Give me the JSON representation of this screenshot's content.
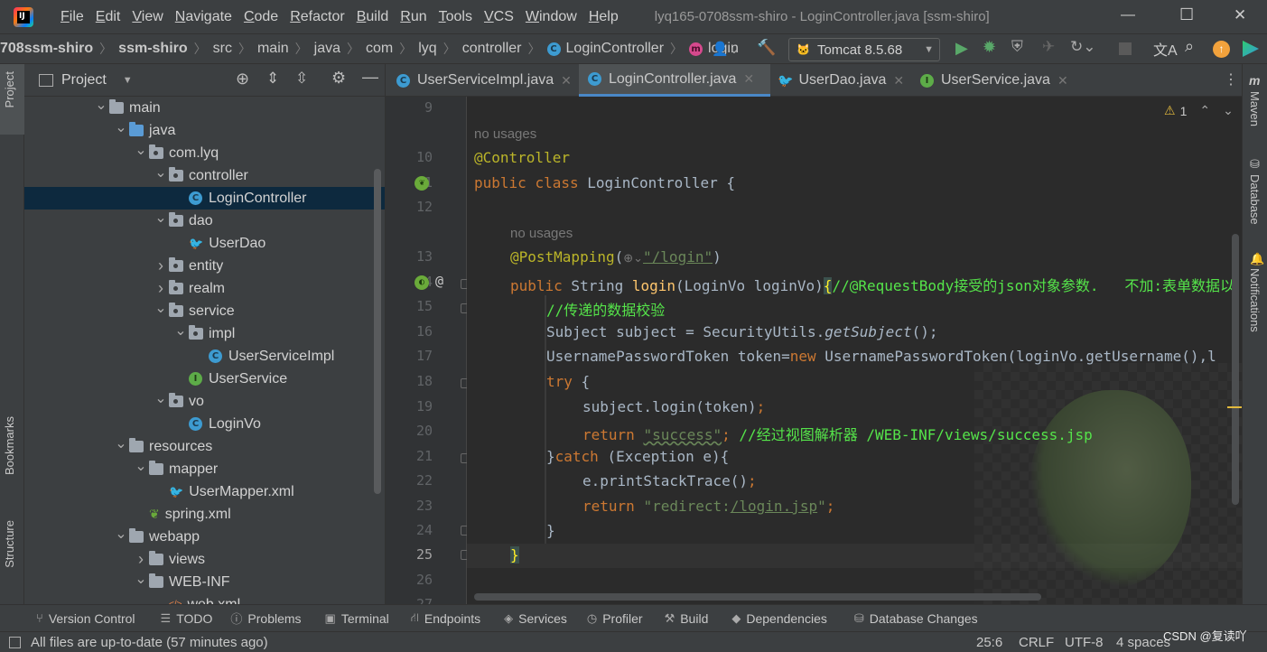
{
  "titlebar": {
    "menus": [
      "File",
      "Edit",
      "View",
      "Navigate",
      "Code",
      "Refactor",
      "Build",
      "Run",
      "Tools",
      "VCS",
      "Window",
      "Help"
    ],
    "window_title": "lyq165-0708ssm-shiro - LoginController.java [ssm-shiro]",
    "minimize": "—",
    "maximize": "☐",
    "close": "✕"
  },
  "breadcrumb": {
    "items": [
      "708ssm-shiro",
      "ssm-shiro",
      "src",
      "main",
      "java",
      "com",
      "lyq",
      "controller",
      "LoginController",
      "login"
    ],
    "run_config": "Tomcat 8.5.68"
  },
  "project_panel": {
    "title": "Project",
    "tree": [
      {
        "label": "main",
        "depth": 0,
        "expanded": true,
        "icon": "folder"
      },
      {
        "label": "java",
        "depth": 1,
        "expanded": true,
        "icon": "folder-blue"
      },
      {
        "label": "com.lyq",
        "depth": 2,
        "expanded": true,
        "icon": "package"
      },
      {
        "label": "controller",
        "depth": 3,
        "expanded": true,
        "icon": "package"
      },
      {
        "label": "LoginController",
        "depth": 4,
        "icon": "class",
        "selected": true
      },
      {
        "label": "dao",
        "depth": 3,
        "expanded": true,
        "icon": "package"
      },
      {
        "label": "UserDao",
        "depth": 4,
        "icon": "mapper"
      },
      {
        "label": "entity",
        "depth": 3,
        "expanded": false,
        "icon": "package"
      },
      {
        "label": "realm",
        "depth": 3,
        "expanded": false,
        "icon": "package"
      },
      {
        "label": "service",
        "depth": 3,
        "expanded": true,
        "icon": "package"
      },
      {
        "label": "impl",
        "depth": 4,
        "expanded": true,
        "icon": "package"
      },
      {
        "label": "UserServiceImpl",
        "depth": 5,
        "icon": "class"
      },
      {
        "label": "UserService",
        "depth": 4,
        "icon": "interface"
      },
      {
        "label": "vo",
        "depth": 3,
        "expanded": true,
        "icon": "package"
      },
      {
        "label": "LoginVo",
        "depth": 4,
        "icon": "class"
      },
      {
        "label": "resources",
        "depth": 1,
        "expanded": true,
        "icon": "folder-res"
      },
      {
        "label": "mapper",
        "depth": 2,
        "expanded": true,
        "icon": "folder"
      },
      {
        "label": "UserMapper.xml",
        "depth": 3,
        "icon": "xml-mapper"
      },
      {
        "label": "spring.xml",
        "depth": 2,
        "icon": "xml-spring"
      },
      {
        "label": "webapp",
        "depth": 1,
        "expanded": true,
        "icon": "folder-web"
      },
      {
        "label": "views",
        "depth": 2,
        "expanded": false,
        "icon": "folder"
      },
      {
        "label": "WEB-INF",
        "depth": 2,
        "expanded": true,
        "icon": "folder"
      },
      {
        "label": "web.xml",
        "depth": 3,
        "icon": "xml"
      }
    ]
  },
  "left_strip": {
    "project": "Project",
    "bookmarks": "Bookmarks",
    "structure": "Structure"
  },
  "right_strip": {
    "maven": "Maven",
    "database": "Database",
    "notifications": "Notifications"
  },
  "tabs": [
    {
      "label": "UserServiceImpl.java",
      "icon": "class",
      "active": false
    },
    {
      "label": "LoginController.java",
      "icon": "class",
      "active": true
    },
    {
      "label": "UserDao.java",
      "icon": "mapper",
      "active": false
    },
    {
      "label": "UserService.java",
      "icon": "interface",
      "active": false
    }
  ],
  "editor": {
    "warning_count": "1",
    "usages_hint": "no usages",
    "line_numbers": [
      "9",
      "10",
      "11",
      "12",
      "13",
      "14",
      "15",
      "16",
      "17",
      "18",
      "19",
      "20",
      "21",
      "22",
      "23",
      "24",
      "25",
      "26",
      "27"
    ],
    "tokens": {
      "ann_controller": "@Controller",
      "kw_public": "public",
      "kw_class": "class",
      "class_name": " LoginController {",
      "ann_postmapping": "@PostMapping",
      "paren_open": "(",
      "globe_hint": "⊕⌄",
      "str_login": "\"/login\"",
      "paren_close": ")",
      "kw_string": " String ",
      "method_login": "login",
      "params": "(LoginVo loginVo)",
      "brace_open": "{",
      "cmt_14": "//@RequestBody接受的json对象参数.   不加:表单数据以",
      "cmt_15": "//传递的数据校验",
      "l16a": "Subject subject = SecurityUtils.",
      "l16b": "getSubject",
      "l16c": "();",
      "l17a": "UsernamePasswordToken token=",
      "kw_new": "new",
      "l17b": " UsernamePasswordToken(loginVo.getUsername(),l",
      "kw_try": "try",
      "l18b": " {",
      "l19a": "subject.login(token)",
      "semicolon": ";",
      "kw_return": "return",
      "str_success": "\"success\"",
      "cmt_20": "//经过视图解析器 /WEB-INF/views/success.jsp",
      "l21a": "}",
      "kw_catch": "catch",
      "l21b": " (Exception e){",
      "l22": "e.printStackTrace()",
      "str_redirect_a": "\"redirect:",
      "str_redirect_b": "/login.jsp",
      "str_redirect_c": "\"",
      "close_brace": "}"
    }
  },
  "bottom_tools": [
    {
      "label": "Version Control",
      "icon": "branch-icon"
    },
    {
      "label": "TODO",
      "icon": "list-icon"
    },
    {
      "label": "Problems",
      "icon": "info-icon"
    },
    {
      "label": "Terminal",
      "icon": "terminal-icon"
    },
    {
      "label": "Endpoints",
      "icon": "endpoints-icon"
    },
    {
      "label": "Services",
      "icon": "services-icon"
    },
    {
      "label": "Profiler",
      "icon": "profiler-icon"
    },
    {
      "label": "Build",
      "icon": "hammer-icon"
    },
    {
      "label": "Dependencies",
      "icon": "layers-icon"
    },
    {
      "label": "Database Changes",
      "icon": "database-icon"
    }
  ],
  "status": {
    "message": "All files are up-to-date (57 minutes ago)",
    "position": "25:6",
    "line_sep": "CRLF",
    "encoding": "UTF-8",
    "indent": "4 spaces",
    "watermark": "CSDN @复读吖"
  }
}
